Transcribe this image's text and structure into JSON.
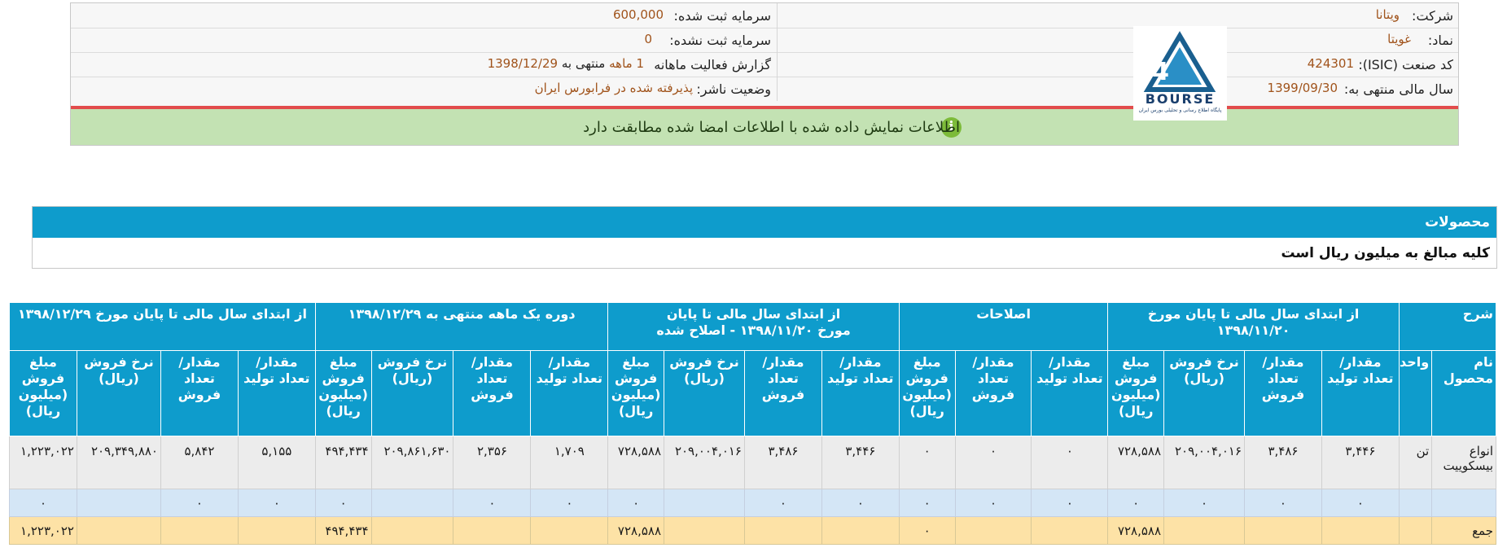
{
  "header": {
    "company_label": "شرکت:",
    "company_value": "ویتانا",
    "symbol_label": "نماد:",
    "symbol_value": "غویتا",
    "isic_label": "کد صنعت (ISIC):",
    "isic_value": "424301",
    "fiscal_label": "سال مالی منتهی به:",
    "fiscal_value": "1399/09/30",
    "reg_capital_label": "سرمایه ثبت شده:",
    "reg_capital_value": "600,000",
    "unreg_capital_label": "سرمایه ثبت نشده:",
    "unreg_capital_value": "0",
    "report_label": "گزارش فعالیت ماهانه",
    "report_months": "1 ماهه",
    "report_ending": "منتهی به",
    "report_date": "1398/12/29",
    "status_label": "وضعیت ناشر:",
    "status_value": "پذیرفته شده در فرابورس ایران",
    "info_message": "اطلاعات نمایش داده شده با اطلاعات امضا شده مطابقت دارد",
    "info_icon": "i"
  },
  "logo": {
    "text": "BOURSE",
    "subtitle": "پایگاه اطلاع رسانی و تحلیلی بورس ایران"
  },
  "products": {
    "title": "محصولات",
    "note": "کلیه مبالغ به میلیون ریال است"
  },
  "table": {
    "group_headers": {
      "desc": "شرح",
      "g1": "از ابتدای سال مالی تا پایان مورخ ۱۳۹۸/۱۱/۲۰",
      "g2": "اصلاحات",
      "g3_line1": "از ابتدای سال مالی تا پایان",
      "g3_line2": "مورخ ۱۳۹۸/۱۱/۲۰ - اصلاح شده",
      "g4": "دوره یک ماهه منتهی به ۱۳۹۸/۱۲/۲۹",
      "g5": "از ابتدای سال مالی تا پایان مورخ ۱۳۹۸/۱۲/۲۹"
    },
    "sub_headers": {
      "product_name": "نام محصول",
      "unit": "واحد",
      "prod_qty": "مقدار/تعداد تولید",
      "sale_qty": "مقدار/تعداد فروش",
      "sale_rate": "نرخ فروش (ریال)",
      "sale_amount": "مبلغ فروش (میلیون ریال)"
    },
    "row1": {
      "name": "انواع بیسکوییت",
      "unit": "تن",
      "g1": [
        "۳,۴۴۶",
        "۳,۴۸۶",
        "۲۰۹,۰۰۴,۰۱۶",
        "۷۲۸,۵۸۸"
      ],
      "g2": [
        "۰",
        "۰",
        "۰"
      ],
      "g3": [
        "۳,۴۴۶",
        "۳,۴۸۶",
        "۲۰۹,۰۰۴,۰۱۶",
        "۷۲۸,۵۸۸"
      ],
      "g4": [
        "۱,۷۰۹",
        "۲,۳۵۶",
        "۲۰۹,۸۶۱,۶۳۰",
        "۴۹۴,۴۳۴"
      ],
      "g5": [
        "۵,۱۵۵",
        "۵,۸۴۲",
        "۲۰۹,۳۴۹,۸۸۰",
        "۱,۲۲۳,۰۲۲"
      ]
    },
    "zero": "۰",
    "total": {
      "label": "جمع",
      "g1_amount": "۷۲۸,۵۸۸",
      "g2_amount": "۰",
      "g3_amount": "۷۲۸,۵۸۸",
      "g4_amount": "۴۹۴,۴۳۴",
      "g5_amount": "۱,۲۲۳,۰۲۲"
    }
  },
  "colors": {
    "accent": "#0e9ccc",
    "info_bg": "#c3e2b3",
    "alert_line": "#e24c4c",
    "value_text": "#a0531b",
    "total_row": "#fde2a6"
  }
}
